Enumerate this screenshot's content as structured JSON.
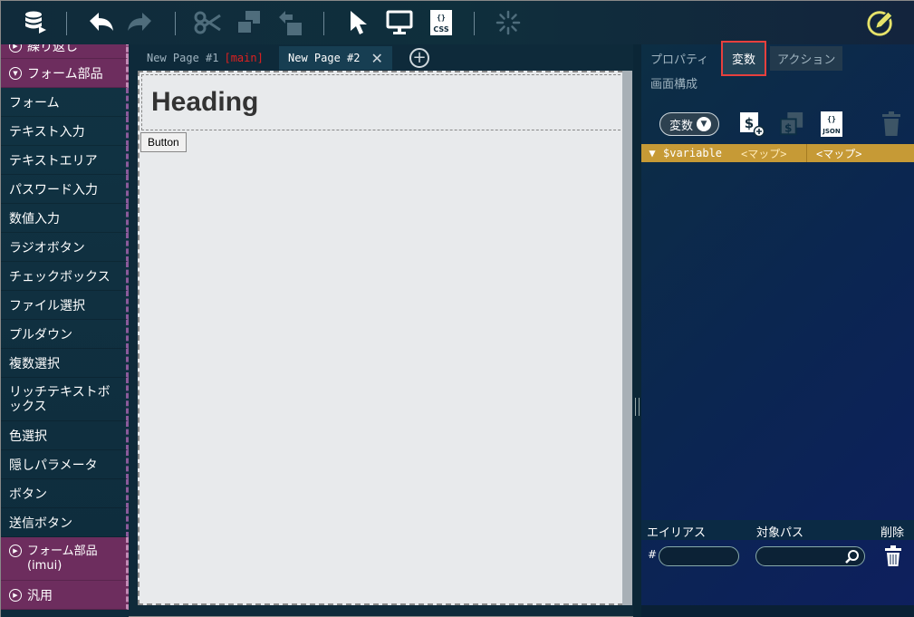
{
  "toolbar": {
    "icons": [
      "database-icon",
      "undo-icon",
      "redo-icon",
      "cut-icon",
      "copy-icon",
      "paste-icon",
      "select-cursor-icon",
      "preview-monitor-icon",
      "css-icon",
      "loading-icon",
      "edit-pencil-icon"
    ],
    "css_label": "CSS",
    "css_braces": "{}"
  },
  "palette": {
    "items": [
      {
        "label": "繰り返し",
        "category": true
      },
      {
        "label": "フォーム部品",
        "category": true
      },
      {
        "label": "フォーム"
      },
      {
        "label": "テキスト入力"
      },
      {
        "label": "テキストエリア"
      },
      {
        "label": "パスワード入力"
      },
      {
        "label": "数値入力"
      },
      {
        "label": "ラジオボタン"
      },
      {
        "label": "チェックボックス"
      },
      {
        "label": "ファイル選択"
      },
      {
        "label": "プルダウン"
      },
      {
        "label": "複数選択"
      },
      {
        "label": "リッチテキストボックス"
      },
      {
        "label": "色選択"
      },
      {
        "label": "隠しパラメータ"
      },
      {
        "label": "ボタン"
      },
      {
        "label": "送信ボタン"
      },
      {
        "label": "フォーム部品\n(imui)",
        "category": true
      },
      {
        "label": "汎用",
        "category": true
      }
    ]
  },
  "tabs": {
    "tab1": {
      "label": "New Page #1",
      "tag": "[main]"
    },
    "tab2": {
      "label": "New Page #2",
      "close": "✕"
    },
    "add": "+"
  },
  "canvas": {
    "heading": "Heading",
    "button": "Button"
  },
  "right": {
    "tabs": {
      "properties": "プロパティ",
      "variables": "変数",
      "actions": "アクション",
      "layout": "画面構成"
    },
    "var_dropdown": "変数",
    "icon_dollar": "$",
    "icon_json_braces": "{}",
    "icon_json": "JSON",
    "variable": {
      "toggle": "▼",
      "name": "$variable",
      "type1": "<マップ>",
      "type2": "<マップ>"
    },
    "alias": {
      "col_alias": "エイリアス",
      "col_path": "対象パス",
      "col_delete": "削除",
      "hash": "#"
    }
  },
  "colors": {
    "accent": "#c69a36",
    "category": "#6d2d5e",
    "highlight_border": "#e8403d"
  }
}
